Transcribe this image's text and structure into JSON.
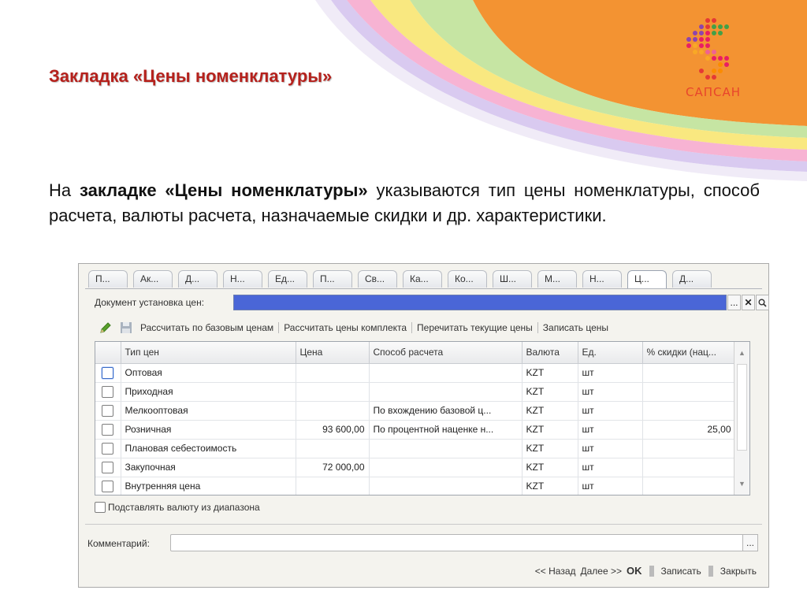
{
  "slide": {
    "title": "Закладка «Цены номенклатуры»",
    "para_prefix": "На ",
    "para_bold": "закладке «Цены номенклатуры»",
    "para_rest": " указываются тип цены номенклатуры, способ расчета, валюты расчета, назначаемые скидки и др. характеристики."
  },
  "logo": {
    "text": "САПСАН"
  },
  "colors": {
    "title": "#b5211c",
    "logo_text": "#e8452c",
    "accent_orange": "#f39332",
    "field_selected": "#4a66d7"
  },
  "form": {
    "tabs": [
      "П...",
      "Ак...",
      "Д...",
      "Н...",
      "Ед...",
      "П...",
      "Св...",
      "Ка...",
      "Ко...",
      "Ш...",
      "М...",
      "Н...",
      "Ц...",
      "Д..."
    ],
    "active_tab_index": 12,
    "doc_label": "Документ установка цен:",
    "doc_btn_select": "...",
    "doc_btn_clear": "✕",
    "doc_btn_open": "🔍",
    "toolbar": {
      "calc_base": "Рассчитать по базовым ценам",
      "calc_kit": "Рассчитать цены комплекта",
      "reread": "Перечитать текущие цены",
      "save_prices": "Записать цены"
    },
    "table": {
      "columns": [
        "Тип цен",
        "Цена",
        "Способ расчета",
        "Валюта",
        "Ед.",
        "% скидки (нац..."
      ],
      "rows": [
        {
          "type": "Оптовая",
          "price": "",
          "method": "",
          "currency": "KZT",
          "unit": "шт",
          "discount": ""
        },
        {
          "type": "Приходная",
          "price": "",
          "method": "",
          "currency": "KZT",
          "unit": "шт",
          "discount": ""
        },
        {
          "type": "Мелкооптовая",
          "price": "",
          "method": "По вхождению базовой ц...",
          "currency": "KZT",
          "unit": "шт",
          "discount": ""
        },
        {
          "type": "Розничная",
          "price": "93 600,00",
          "method": "По процентной наценке н...",
          "currency": "KZT",
          "unit": "шт",
          "discount": "25,00"
        },
        {
          "type": "Плановая себестоимость",
          "price": "",
          "method": "",
          "currency": "KZT",
          "unit": "шт",
          "discount": ""
        },
        {
          "type": "Закупочная",
          "price": "72 000,00",
          "method": "",
          "currency": "KZT",
          "unit": "шт",
          "discount": ""
        },
        {
          "type": "Внутренняя цена",
          "price": "",
          "method": "",
          "currency": "KZT",
          "unit": "шт",
          "discount": ""
        }
      ]
    },
    "option_label": "Подставлять валюту из диапазона",
    "comment_label": "Комментарий:",
    "comment_value": "",
    "comment_btn": "...",
    "footer": {
      "back": "<< Назад",
      "next": "Далее >>",
      "ok": "OK",
      "save": "Записать",
      "close": "Закрыть"
    }
  }
}
